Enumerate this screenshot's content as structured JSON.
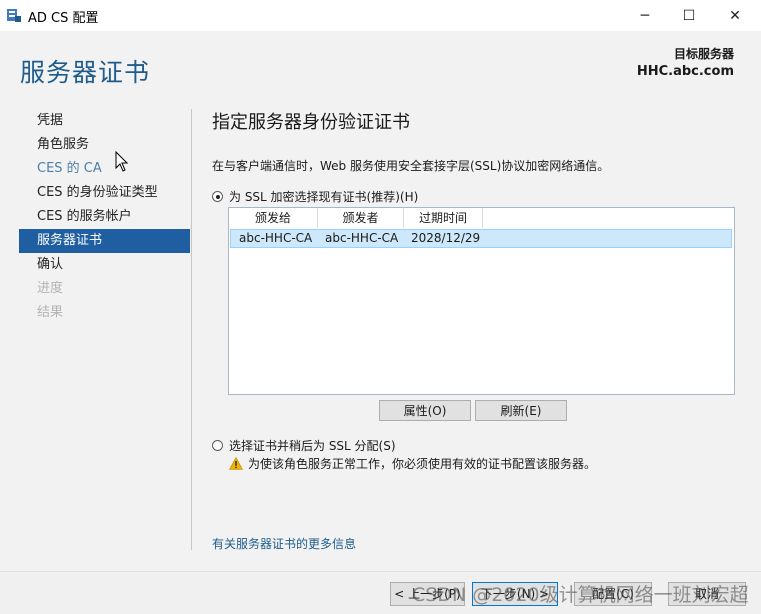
{
  "window": {
    "title": "AD CS 配置",
    "minimize_glyph": "─",
    "maximize_glyph": "☐",
    "close_glyph": "✕"
  },
  "header": {
    "page_title": "服务器证书",
    "target_label": "目标服务器",
    "target_value": "HHC.abc.com"
  },
  "sidebar": {
    "items": [
      {
        "label": "凭据",
        "state": "normal"
      },
      {
        "label": "角色服务",
        "state": "normal"
      },
      {
        "label": "CES 的 CA",
        "state": "link"
      },
      {
        "label": "CES 的身份验证类型",
        "state": "normal"
      },
      {
        "label": "CES 的服务帐户",
        "state": "normal"
      },
      {
        "label": "服务器证书",
        "state": "active"
      },
      {
        "label": "确认",
        "state": "normal"
      },
      {
        "label": "进度",
        "state": "disabled"
      },
      {
        "label": "结果",
        "state": "disabled"
      }
    ]
  },
  "content": {
    "section_title": "指定服务器身份验证证书",
    "description": "在与客户端通信时，Web 服务使用安全套接字层(SSL)协议加密网络通信。",
    "option_existing": "为 SSL 加密选择现有证书(推荐)(H)",
    "option_later": "选择证书并稍后为 SSL 分配(S)",
    "warning_text": "为使该角色服务正常工作，你必须使用有效的证书配置该服务器。",
    "more_info_link": "有关服务器证书的更多信息"
  },
  "cert_table": {
    "columns": [
      "颁发给",
      "颁发者",
      "过期时间"
    ],
    "rows": [
      {
        "issued_to": "abc-HHC-CA",
        "issued_by": "abc-HHC-CA",
        "expires": "2028/12/29"
      }
    ]
  },
  "buttons": {
    "properties": "属性(O)",
    "refresh": "刷新(E)",
    "prev": "< 上一步(P)",
    "next": "下一步(N) >",
    "configure": "配置(C)",
    "cancel": "取消"
  },
  "watermark": "CSDN @2020级计算机网络一班刘宏超",
  "colors": {
    "accent": "#1e5c8c",
    "nav_active_bg": "#1f5fa1",
    "selection_bg": "#cde8fb",
    "warning": "#f0b400"
  }
}
